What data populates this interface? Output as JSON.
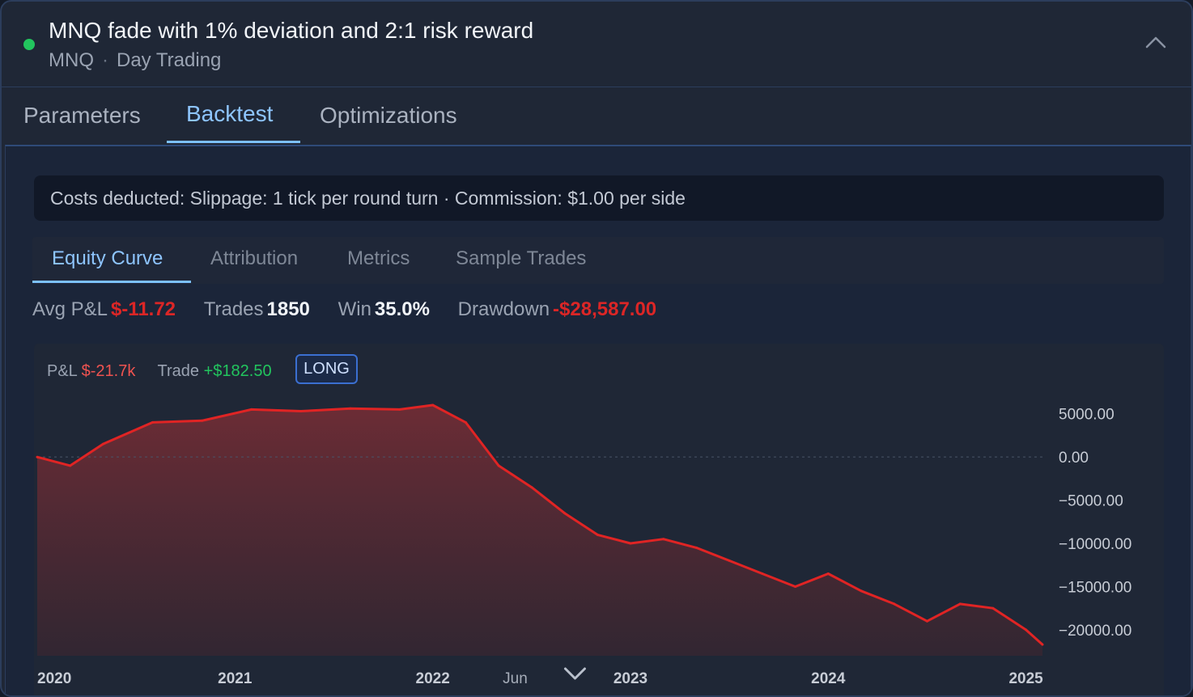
{
  "header": {
    "title": "MNQ fade with 1% deviation and 2:1 risk reward",
    "symbol": "MNQ",
    "separator": "·",
    "category": "Day Trading",
    "status_color": "#22c55e",
    "status_icon": "status-dot",
    "collapse_icon": "chevron-up-icon"
  },
  "tabs": [
    {
      "label": "Parameters",
      "active": false
    },
    {
      "label": "Backtest",
      "active": true
    },
    {
      "label": "Optimizations",
      "active": false
    }
  ],
  "costs_note": "Costs deducted: Slippage: 1 tick per round turn · Commission: $1.00 per side",
  "subtabs": [
    {
      "label": "Equity Curve",
      "active": true
    },
    {
      "label": "Attribution",
      "active": false
    },
    {
      "label": "Metrics",
      "active": false
    },
    {
      "label": "Sample Trades",
      "active": false
    }
  ],
  "stats": {
    "avg_pnl_label": "Avg P&L",
    "avg_pnl_value": "$-11.72",
    "trades_label": "Trades",
    "trades_value": "1850",
    "win_label": "Win",
    "win_value": "35.0%",
    "drawdown_label": "Drawdown",
    "drawdown_value": "-$28,587.00"
  },
  "legend": {
    "pnl_label": "P&L",
    "pnl_value": "$-21.7k",
    "trade_label": "Trade",
    "trade_value": "+$182.50",
    "side_badge": "LONG"
  },
  "colors": {
    "accent": "#7cc0ff",
    "negative": "#dc2626",
    "positive": "#22c55e",
    "line": "#e02424"
  },
  "chart_data": {
    "type": "area",
    "x": [
      "2020-01",
      "2020-03",
      "2020-05",
      "2020-08",
      "2020-11",
      "2021-02",
      "2021-05",
      "2021-08",
      "2021-11",
      "2022-01",
      "2022-03",
      "2022-05",
      "2022-07",
      "2022-09",
      "2022-11",
      "2023-01",
      "2023-03",
      "2023-05",
      "2023-07",
      "2023-09",
      "2023-11",
      "2024-01",
      "2024-03",
      "2024-05",
      "2024-07",
      "2024-09",
      "2024-11",
      "2025-01",
      "2025-02"
    ],
    "values": [
      0,
      -1000,
      1500,
      4000,
      4200,
      5500,
      5300,
      5600,
      5500,
      6000,
      4000,
      -1000,
      -3500,
      -6500,
      -9000,
      -10000,
      -9500,
      -10500,
      -12000,
      -13500,
      -15000,
      -13500,
      -15500,
      -17000,
      -19000,
      -17000,
      -17500,
      -20000,
      -21700
    ],
    "ylim": [
      -23000,
      7500
    ],
    "y_ticks": [
      "5000.00",
      "0.00",
      "−5000.00",
      "−10000.00",
      "−15000.00",
      "−20000.00"
    ],
    "y_tick_values": [
      5000,
      0,
      -5000,
      -10000,
      -15000,
      -20000
    ],
    "x_ticks": [
      {
        "label": "2020",
        "at": "2020-01",
        "major": true
      },
      {
        "label": "2021",
        "at": "2021-01",
        "major": true
      },
      {
        "label": "2022",
        "at": "2022-01",
        "major": true
      },
      {
        "label": "Jun",
        "at": "2022-06",
        "major": false
      },
      {
        "label": "2023",
        "at": "2023-01",
        "major": true
      },
      {
        "label": "2024",
        "at": "2024-01",
        "major": true
      },
      {
        "label": "2025",
        "at": "2025-01",
        "major": true
      }
    ],
    "zero_line": true,
    "grid": false
  }
}
